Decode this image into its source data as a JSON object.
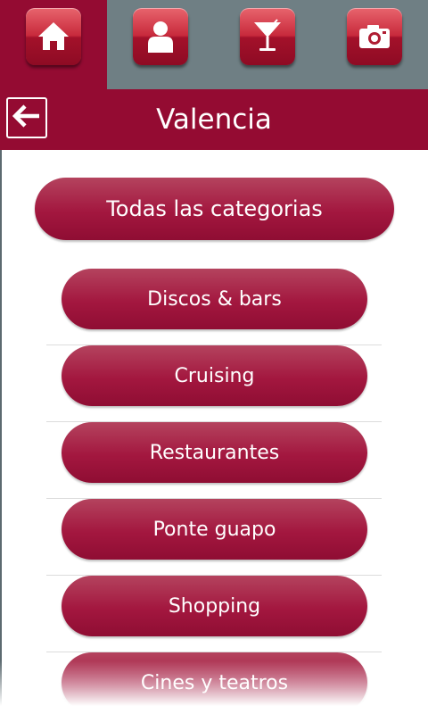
{
  "tabs": [
    {
      "icon": "home-icon",
      "active": true
    },
    {
      "icon": "user-icon",
      "active": false
    },
    {
      "icon": "cocktail-icon",
      "active": false
    },
    {
      "icon": "camera-icon",
      "active": false
    }
  ],
  "header": {
    "title": "Valencia",
    "back_icon": "arrow-left-icon"
  },
  "main_button": {
    "label": "Todas las categorias"
  },
  "categories": [
    {
      "label": "Discos & bars"
    },
    {
      "label": "Cruising"
    },
    {
      "label": "Restaurantes"
    },
    {
      "label": "Ponte guapo"
    },
    {
      "label": "Shopping"
    },
    {
      "label": "Cines y teatros"
    }
  ],
  "colors": {
    "brand": "#940b32",
    "tabbar": "#6f7f84",
    "button": "#a3173f"
  }
}
